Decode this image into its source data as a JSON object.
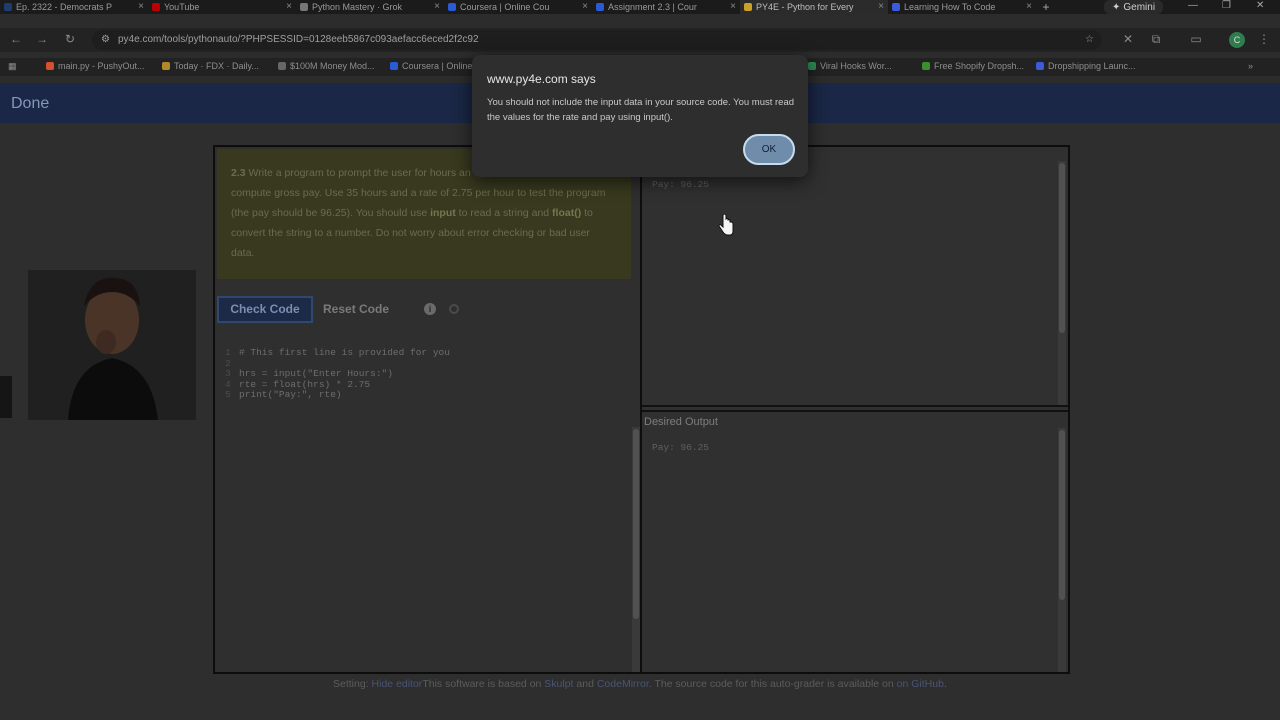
{
  "browser": {
    "tabs": [
      {
        "title": "Ep. 2322 - Democrats P",
        "icon": "dw-favicon",
        "color": "#1f3b6f"
      },
      {
        "title": "YouTube",
        "icon": "youtube-favicon",
        "color": "#c00000"
      },
      {
        "title": "Python Mastery · Grok",
        "icon": "grok-favicon",
        "color": "#777777"
      },
      {
        "title": "Coursera | Online Cou",
        "icon": "coursera-favicon",
        "color": "#2a5bd7"
      },
      {
        "title": "Assignment 2.3 | Cour",
        "icon": "coursera-favicon",
        "color": "#2a5bd7"
      },
      {
        "title": "PY4E - Python for Every",
        "icon": "python-favicon",
        "color": "#c9a227"
      },
      {
        "title": "Learning How To Code",
        "icon": "learning-favicon",
        "color": "#3b5bdb"
      }
    ],
    "new_tab_label": "+",
    "gemini_label": "Gemini",
    "url": "py4e.com/tools/pythonauto/?PHPSESSID=0128eeb5867c093aefacc6eced2f2c92",
    "bookmarks": [
      {
        "label": "main.py - PushyOut...",
        "color": "#d0532c"
      },
      {
        "label": "Today · FDX · Daily...",
        "color": "#b08a2a"
      },
      {
        "label": "$100M Money Mod...",
        "color": "#666666"
      },
      {
        "label": "Coursera | Online...",
        "color": "#2a5bd7"
      },
      {
        "label": "Viral Hooks Wor...",
        "color": "#2e8b57"
      },
      {
        "label": "Free Shopify Dropsh...",
        "color": "#3c8d2f"
      },
      {
        "label": "Dropshipping Launc...",
        "color": "#3b5bdb"
      }
    ]
  },
  "site": {
    "header_label": "Done"
  },
  "question": {
    "number": "2.3",
    "text_a": " Write a program to prompt the user for hours an",
    "text_b": "compute gross pay. Use 35 hours and a rate of 2.75 per hour to test the program",
    "text_c": "(the pay should be 96.25). You should use ",
    "input_word": "input",
    "text_d": " to read a string and ",
    "float_word": "float()",
    "text_e": " to",
    "text_f": "convert the string to a number. Do not worry about error checking or bad user",
    "text_g": "data."
  },
  "buttons": {
    "check": "Check Code",
    "reset": "Reset Code",
    "info": "i"
  },
  "code_lines": [
    {
      "n": "1",
      "text": "# This first line is provided for you"
    },
    {
      "n": "2",
      "text": ""
    },
    {
      "n": "3",
      "text": "hrs = input(\"Enter Hours:\")"
    },
    {
      "n": "4",
      "text": "rte = float(hrs) * 2.75"
    },
    {
      "n": "5",
      "text": "print(\"Pay:\", rte)"
    }
  ],
  "output": {
    "your_output": "Pay: 96.25",
    "desired_title": "Desired Output",
    "desired_output": "Pay: 96.25"
  },
  "footer": {
    "setting": "Setting: ",
    "hide_editor": "Hide editor",
    "based_on": "This software is based on ",
    "skulpt": "Skulpt",
    "and": " and ",
    "codemirror": "CodeMirror",
    "source_text": ". The source code for this auto-grader is available on ",
    "github": "on GitHub",
    "period": "."
  },
  "dialog": {
    "title": "www.py4e.com says",
    "message": "You should not include the input data in your source code. You must read the values for the rate and pay using input().",
    "ok_label": "OK"
  }
}
